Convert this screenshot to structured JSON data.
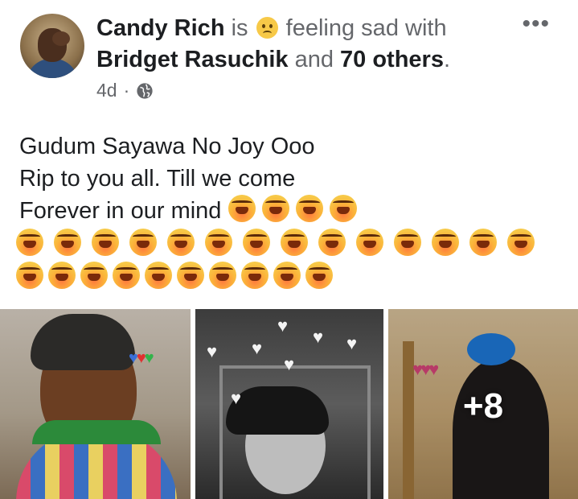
{
  "post": {
    "author": "Candy Rich",
    "connector_is": "is",
    "feeling": "feeling sad with",
    "feeling_emoji": "sad-face-emoji",
    "tagged_name": "Bridget Rasuchik",
    "connector_and": "and",
    "others": "70 others",
    "period": ".",
    "time": "4d",
    "separator": "·",
    "privacy_icon": "globe-icon",
    "more_icon": "more-options-icon",
    "text_lines": [
      "Gudum Sayawa No Joy Ooo",
      "Rip to you all. Till we come",
      "Forever in our mind"
    ],
    "emoji_name": "loudly-crying-face-emoji",
    "emoji_counts": {
      "line3": 4,
      "row_a": 14,
      "row_b": 10
    },
    "photos_more": "+8"
  }
}
